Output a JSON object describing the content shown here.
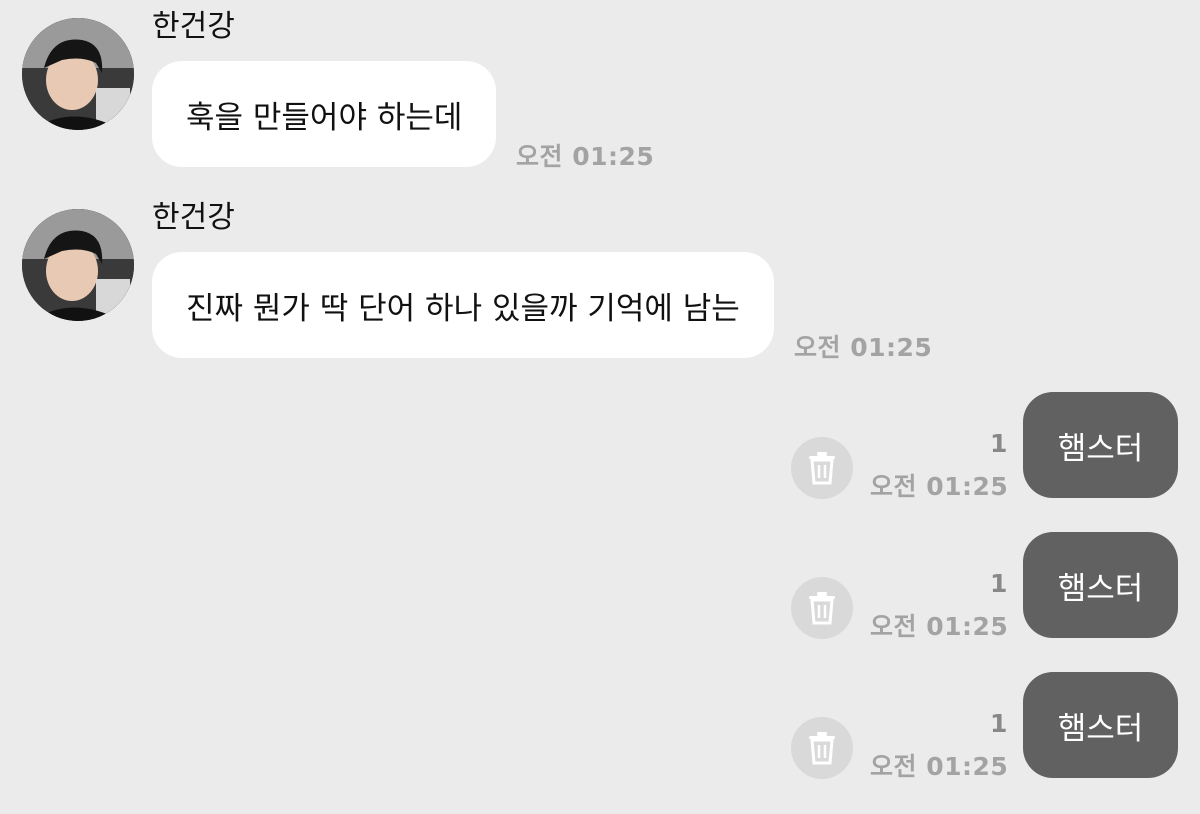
{
  "incoming": [
    {
      "sender": "한건강",
      "text": "훅을 만들어야 하는데",
      "time": "오전 01:25"
    },
    {
      "sender": "한건강",
      "text": "진짜 뭔가 딱 단어 하나 있을까 기억에 남는",
      "time": "오전 01:25"
    }
  ],
  "outgoing": [
    {
      "text": "햄스터",
      "unread": "1",
      "time": "오전 01:25",
      "icon": "trash-icon"
    },
    {
      "text": "햄스터",
      "unread": "1",
      "time": "오전 01:25",
      "icon": "trash-icon"
    },
    {
      "text": "햄스터",
      "unread": "1",
      "time": "오전 01:25",
      "icon": "trash-icon"
    }
  ],
  "colors": {
    "background": "#ebebeb",
    "incoming_bubble": "#ffffff",
    "outgoing_bubble": "#616161",
    "timestamp": "#a3a3a3"
  }
}
